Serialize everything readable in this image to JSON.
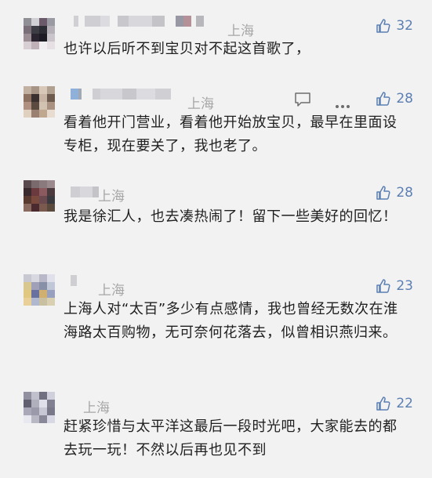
{
  "comments": [
    {
      "location": "上海",
      "likes": "32",
      "text": "也许以后听不到宝贝对不起这首歌了，",
      "avatar_colors": [
        "#8f8f95",
        "#cfcfd4",
        "#6a5a6a",
        "#9a9aa2",
        "#7a6e78",
        "#3c3c44",
        "#2c2c34",
        "#b5b0b8",
        "#9c8c94",
        "#2a2530",
        "#1c1a22",
        "#c9c4ca",
        "#d7cfd4",
        "#c0b0b8",
        "#f0eef0",
        "#e6e0e4"
      ]
    },
    {
      "location": "上海",
      "likes": "28",
      "text": "看着他开门营业，看着他开始放宝贝，最早在里面设专柜，现在要关了，我也老了。",
      "avatar_colors": [
        "#c2b0a0",
        "#a89484",
        "#d8c8b8",
        "#b0a090",
        "#8c7060",
        "#3a3030",
        "#c8b4a4",
        "#6c5a4e",
        "#b09080",
        "#5a4a40",
        "#d2c2b2",
        "#aa9282",
        "#e0d0c0",
        "#9a8070",
        "#c0a890",
        "#e8dcd0"
      ]
    },
    {
      "location": "上海",
      "likes": "28",
      "text": "我是徐汇人，也去凑热闹了！留下一些美好的回忆！",
      "avatar_colors": [
        "#5a4a4e",
        "#7a6a6e",
        "#8a7a7e",
        "#9a8a8e",
        "#3a2a2e",
        "#6a3a3e",
        "#8a5a5e",
        "#4a3a3e",
        "#5a3a2e",
        "#7a4a3e",
        "#6a4a4e",
        "#3a3a3e",
        "#8a6a5e",
        "#4a2a2e",
        "#7a5a4e",
        "#5a4a3e"
      ]
    },
    {
      "location": "上海",
      "likes": "23",
      "text": "上海人对“太百”多少有点感情，我也曾经无数次在淮海路太百购物，无可奈何花落去，似曾相识燕归来。",
      "avatar_colors": [
        "#c8c8d2",
        "#d8d8e0",
        "#b8b8c8",
        "#e0e0ea",
        "#d8c890",
        "#a0a0b8",
        "#8890a8",
        "#c0c8d8",
        "#e0c880",
        "#6870a0",
        "#d0b070",
        "#98a0c0",
        "#e8d098",
        "#b0b8d0",
        "#c8c0a0",
        "#d8d0b0"
      ]
    },
    {
      "location": "上海",
      "likes": "22",
      "text": "赶紧珍惜与太平洋这最后一段时光吧，大家能去的都去玩一玩！不然以后再也见不到",
      "avatar_colors": [
        "#9090a0",
        "#c0c0cc",
        "#707080",
        "#d0d0dc",
        "#606070",
        "#b0b0bc",
        "#e0e0ea",
        "#808090",
        "#a8a8b8",
        "#9a9aaa",
        "#c8c8d4",
        "#787888",
        "#e8e8f0",
        "#b8b8c4",
        "#888898",
        "#d8d8e4"
      ]
    }
  ],
  "colors": {
    "like": "#5b7fb3",
    "location": "#a6a6a6",
    "text": "#1f1f1f",
    "background": "#f2f2f2"
  },
  "icons": {
    "like": "thumbs-up-icon",
    "reply": "comment-icon",
    "more": "more-dots-icon"
  }
}
